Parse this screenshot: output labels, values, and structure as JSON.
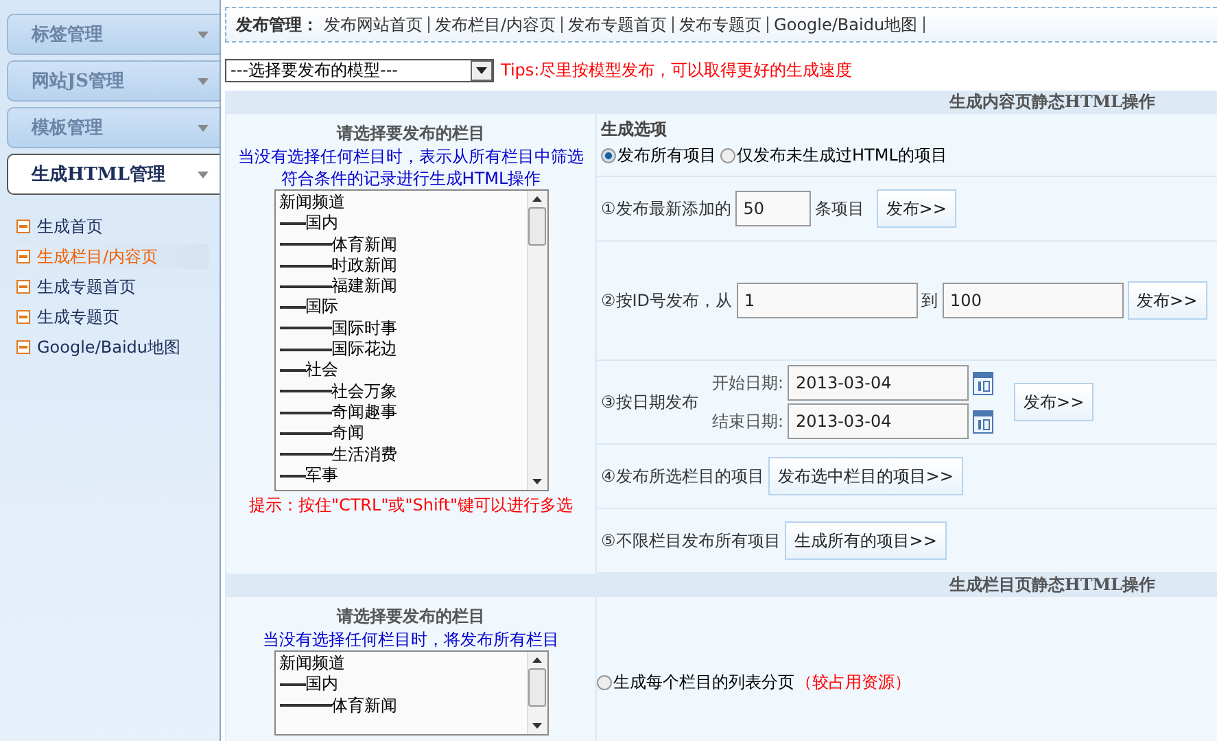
{
  "sidebar": {
    "menus": [
      {
        "label": "标签管理",
        "expanded": false
      },
      {
        "label": "网站JS管理",
        "expanded": false
      },
      {
        "label": "模板管理",
        "expanded": false
      },
      {
        "label": "生成HTML管理",
        "expanded": true
      }
    ],
    "items": [
      {
        "label": "生成首页",
        "selected": false
      },
      {
        "label": "生成栏目/内容页",
        "selected": true
      },
      {
        "label": "生成专题首页",
        "selected": false
      },
      {
        "label": "生成专题页",
        "selected": false
      },
      {
        "label": "Google/Baidu地图",
        "selected": false
      }
    ]
  },
  "breadcrumb": {
    "title": "发布管理：",
    "links": [
      "发布网站首页",
      "发布栏目/内容页",
      "发布专题首页",
      "发布专题页",
      "Google/Baidu地图"
    ]
  },
  "model_select": {
    "value": "---选择要发布的模型---"
  },
  "tips": "Tips:尽里按模型发布，可以取得更好的生成速度",
  "content_section": {
    "header": "生成内容页静态HTML操作",
    "picker": {
      "title": "请选择要发布的栏目",
      "note": "当没有选择任何栏目时，表示从所有栏目中筛选符合条件的记录进行生成HTML操作",
      "hint": "提示：按住\"CTRL\"或\"Shift\"键可以进行多选",
      "items": [
        {
          "label": "新闻频道",
          "children": [
            {
              "label": "国内",
              "children": [
                {
                  "label": "体育新闻"
                },
                {
                  "label": "时政新闻"
                },
                {
                  "label": "福建新闻"
                }
              ]
            },
            {
              "label": "国际",
              "children": [
                {
                  "label": "国际时事"
                },
                {
                  "label": "国际花边"
                }
              ]
            },
            {
              "label": "社会",
              "children": [
                {
                  "label": "社会万象"
                },
                {
                  "label": "奇闻趣事"
                },
                {
                  "label": "奇闻"
                },
                {
                  "label": "生活消费"
                }
              ]
            },
            {
              "label": "军事"
            }
          ]
        }
      ]
    },
    "options_title": "生成选项",
    "scope": [
      {
        "label": "发布所有项目",
        "selected": true
      },
      {
        "label": "仅发布未生成过HTML的项目",
        "selected": false
      }
    ],
    "rows": [
      {
        "kind": "latest",
        "label": "①发布最新添加的",
        "value": "50",
        "unit": "条项目",
        "button": "发布>>"
      },
      {
        "kind": "id_range",
        "label": "②按ID号发布，从",
        "from": "1",
        "to_label": "到",
        "to": "100",
        "button": "发布>>"
      },
      {
        "kind": "date_range",
        "label": "③按日期发布",
        "start_label": "开始日期:",
        "start": "2013-03-04",
        "end_label": "结束日期:",
        "end": "2013-03-04",
        "button": "发布>>"
      },
      {
        "kind": "button",
        "label": "④发布所选栏目的项目",
        "button": "发布选中栏目的项目>>"
      },
      {
        "kind": "button",
        "label": "⑤不限栏目发布所有项目",
        "button": "生成所有的项目>>"
      }
    ]
  },
  "column_section": {
    "header": "生成栏目页静态HTML操作",
    "picker": {
      "title": "请选择要发布的栏目",
      "note": "当没有选择任何栏目时，将发布所有栏目",
      "items": [
        {
          "label": "新闻频道",
          "children": [
            {
              "label": "国内",
              "children": [
                {
                  "label": "体育新闻"
                }
              ]
            }
          ]
        }
      ]
    },
    "option": {
      "label": "生成每个栏目的列表分页",
      "note": "（较占用资源）",
      "selected": false
    }
  }
}
